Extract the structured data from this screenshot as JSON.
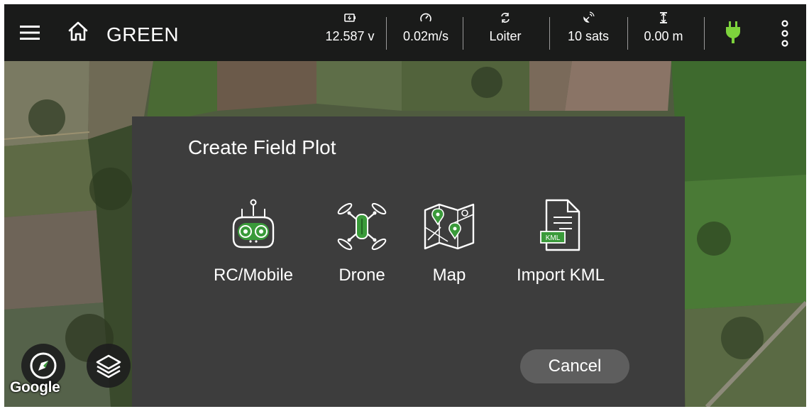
{
  "header": {
    "title": "GREEN",
    "stats": [
      {
        "icon": "battery-icon",
        "value": "12.587 v"
      },
      {
        "icon": "speedometer-icon",
        "value": "0.02m/s"
      },
      {
        "icon": "flight-mode-icon",
        "value": "Loiter"
      },
      {
        "icon": "satellite-icon",
        "value": "10 sats"
      },
      {
        "icon": "altitude-icon",
        "value": "0.00 m"
      }
    ],
    "power_icon": "plug-icon",
    "menu_icon": "more-vert-icon"
  },
  "dialog": {
    "title": "Create Field Plot",
    "options": [
      {
        "label": "RC/Mobile",
        "icon": "rc-controller-icon"
      },
      {
        "label": "Drone",
        "icon": "drone-icon"
      },
      {
        "label": "Map",
        "icon": "map-icon"
      },
      {
        "label": "Import KML",
        "icon": "kml-file-icon",
        "badge": "KML"
      }
    ],
    "cancel_label": "Cancel"
  },
  "map": {
    "attribution": "Google",
    "compass_icon": "compass-icon",
    "layers_icon": "layers-icon"
  },
  "colors": {
    "accent_green": "#3a9a3a",
    "plug_green": "#7dd33c",
    "dialog_bg": "#3d3d3d",
    "topbar_bg": "#191919"
  }
}
